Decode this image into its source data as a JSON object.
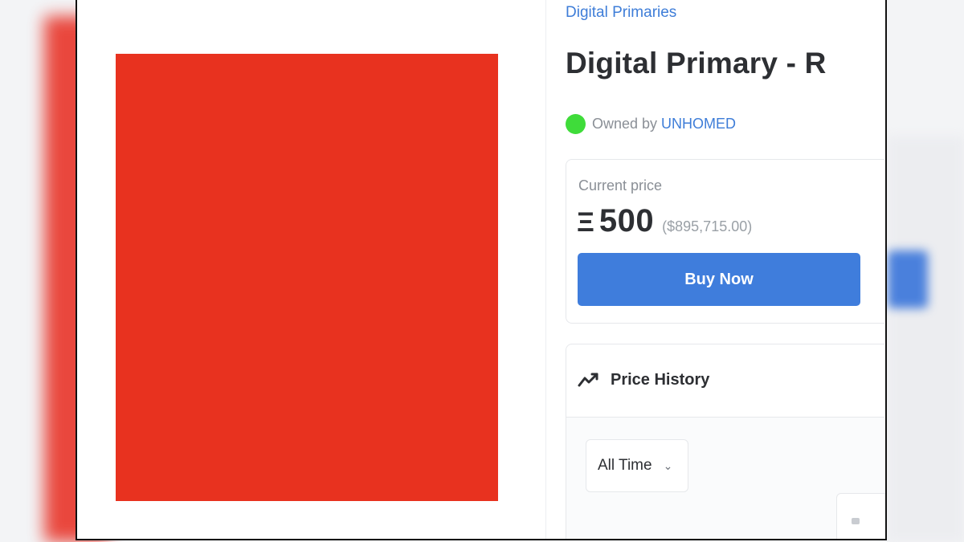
{
  "collection": {
    "link_text": "Digital Primaries"
  },
  "item": {
    "title": "Digital Primary - R"
  },
  "owner": {
    "prefix": "Owned by",
    "name": "UNHOMED"
  },
  "price": {
    "label": "Current price",
    "currency_symbol": "Ξ",
    "amount": "500",
    "usd": "($895,715.00)",
    "buy_label": "Buy Now"
  },
  "history": {
    "title": "Price History",
    "icon": "trending-chart-icon",
    "range": "All Time"
  },
  "colors": {
    "artwork": "#e8321f",
    "accent": "#3f7ddc",
    "owner_status": "#3fdc3a"
  }
}
